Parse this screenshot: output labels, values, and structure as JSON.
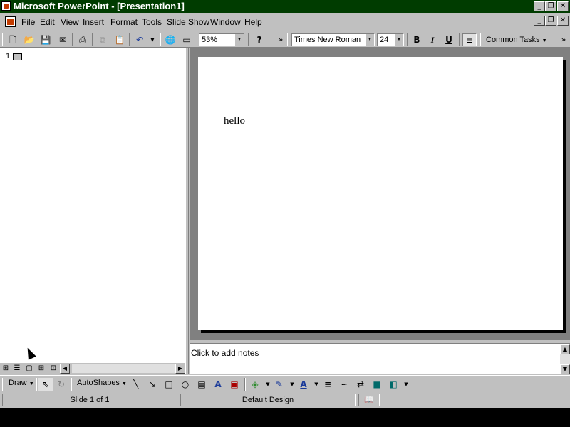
{
  "window": {
    "title": "Microsoft PowerPoint - [Presentation1]",
    "title_color": "#003c00",
    "caption_buttons": [
      "_",
      "❐",
      "✕"
    ],
    "doc_caption_buttons": [
      "_",
      "❐",
      "✕"
    ]
  },
  "menubar": {
    "items": [
      "File",
      "Edit",
      "View",
      "Insert",
      "Format",
      "Tools",
      "Slide Show",
      "Window",
      "Help"
    ]
  },
  "toolbar": {
    "zoom": "53%",
    "font_name": "Times New Roman",
    "font_size": "24",
    "bold": "B",
    "italic": "I",
    "underline": "U",
    "common_tasks": "Common Tasks",
    "more": "»"
  },
  "outline": {
    "slide_number": "1"
  },
  "slide": {
    "text": "hello"
  },
  "notes": {
    "placeholder": "Click to add notes"
  },
  "drawbar": {
    "draw_label": "Draw",
    "autoshapes_label": "AutoShapes"
  },
  "statusbar": {
    "slide_info": "Slide 1 of 1",
    "design": "Default Design"
  }
}
